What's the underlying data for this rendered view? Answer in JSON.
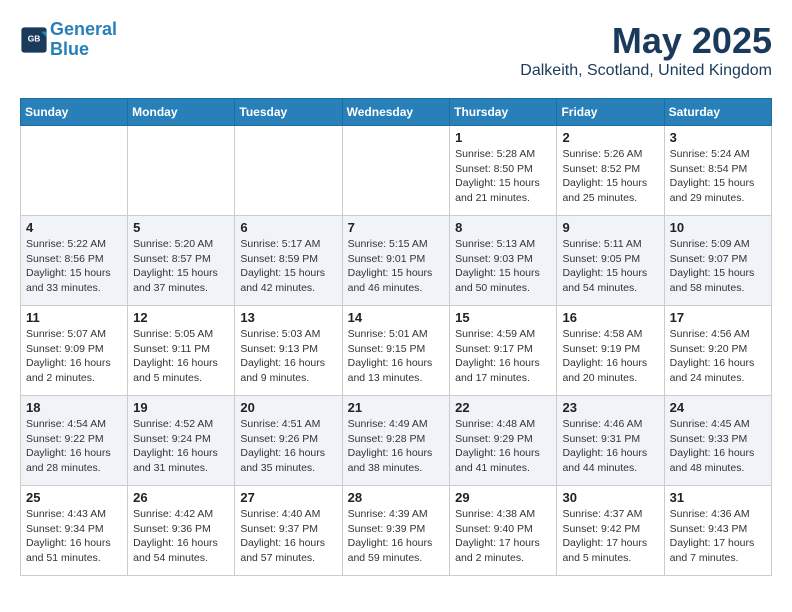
{
  "header": {
    "logo_line1": "General",
    "logo_line2": "Blue",
    "month_year": "May 2025",
    "location": "Dalkeith, Scotland, United Kingdom"
  },
  "days_of_week": [
    "Sunday",
    "Monday",
    "Tuesday",
    "Wednesday",
    "Thursday",
    "Friday",
    "Saturday"
  ],
  "weeks": [
    [
      {
        "day": "",
        "info": ""
      },
      {
        "day": "",
        "info": ""
      },
      {
        "day": "",
        "info": ""
      },
      {
        "day": "",
        "info": ""
      },
      {
        "day": "1",
        "info": "Sunrise: 5:28 AM\nSunset: 8:50 PM\nDaylight: 15 hours\nand 21 minutes."
      },
      {
        "day": "2",
        "info": "Sunrise: 5:26 AM\nSunset: 8:52 PM\nDaylight: 15 hours\nand 25 minutes."
      },
      {
        "day": "3",
        "info": "Sunrise: 5:24 AM\nSunset: 8:54 PM\nDaylight: 15 hours\nand 29 minutes."
      }
    ],
    [
      {
        "day": "4",
        "info": "Sunrise: 5:22 AM\nSunset: 8:56 PM\nDaylight: 15 hours\nand 33 minutes."
      },
      {
        "day": "5",
        "info": "Sunrise: 5:20 AM\nSunset: 8:57 PM\nDaylight: 15 hours\nand 37 minutes."
      },
      {
        "day": "6",
        "info": "Sunrise: 5:17 AM\nSunset: 8:59 PM\nDaylight: 15 hours\nand 42 minutes."
      },
      {
        "day": "7",
        "info": "Sunrise: 5:15 AM\nSunset: 9:01 PM\nDaylight: 15 hours\nand 46 minutes."
      },
      {
        "day": "8",
        "info": "Sunrise: 5:13 AM\nSunset: 9:03 PM\nDaylight: 15 hours\nand 50 minutes."
      },
      {
        "day": "9",
        "info": "Sunrise: 5:11 AM\nSunset: 9:05 PM\nDaylight: 15 hours\nand 54 minutes."
      },
      {
        "day": "10",
        "info": "Sunrise: 5:09 AM\nSunset: 9:07 PM\nDaylight: 15 hours\nand 58 minutes."
      }
    ],
    [
      {
        "day": "11",
        "info": "Sunrise: 5:07 AM\nSunset: 9:09 PM\nDaylight: 16 hours\nand 2 minutes."
      },
      {
        "day": "12",
        "info": "Sunrise: 5:05 AM\nSunset: 9:11 PM\nDaylight: 16 hours\nand 5 minutes."
      },
      {
        "day": "13",
        "info": "Sunrise: 5:03 AM\nSunset: 9:13 PM\nDaylight: 16 hours\nand 9 minutes."
      },
      {
        "day": "14",
        "info": "Sunrise: 5:01 AM\nSunset: 9:15 PM\nDaylight: 16 hours\nand 13 minutes."
      },
      {
        "day": "15",
        "info": "Sunrise: 4:59 AM\nSunset: 9:17 PM\nDaylight: 16 hours\nand 17 minutes."
      },
      {
        "day": "16",
        "info": "Sunrise: 4:58 AM\nSunset: 9:19 PM\nDaylight: 16 hours\nand 20 minutes."
      },
      {
        "day": "17",
        "info": "Sunrise: 4:56 AM\nSunset: 9:20 PM\nDaylight: 16 hours\nand 24 minutes."
      }
    ],
    [
      {
        "day": "18",
        "info": "Sunrise: 4:54 AM\nSunset: 9:22 PM\nDaylight: 16 hours\nand 28 minutes."
      },
      {
        "day": "19",
        "info": "Sunrise: 4:52 AM\nSunset: 9:24 PM\nDaylight: 16 hours\nand 31 minutes."
      },
      {
        "day": "20",
        "info": "Sunrise: 4:51 AM\nSunset: 9:26 PM\nDaylight: 16 hours\nand 35 minutes."
      },
      {
        "day": "21",
        "info": "Sunrise: 4:49 AM\nSunset: 9:28 PM\nDaylight: 16 hours\nand 38 minutes."
      },
      {
        "day": "22",
        "info": "Sunrise: 4:48 AM\nSunset: 9:29 PM\nDaylight: 16 hours\nand 41 minutes."
      },
      {
        "day": "23",
        "info": "Sunrise: 4:46 AM\nSunset: 9:31 PM\nDaylight: 16 hours\nand 44 minutes."
      },
      {
        "day": "24",
        "info": "Sunrise: 4:45 AM\nSunset: 9:33 PM\nDaylight: 16 hours\nand 48 minutes."
      }
    ],
    [
      {
        "day": "25",
        "info": "Sunrise: 4:43 AM\nSunset: 9:34 PM\nDaylight: 16 hours\nand 51 minutes."
      },
      {
        "day": "26",
        "info": "Sunrise: 4:42 AM\nSunset: 9:36 PM\nDaylight: 16 hours\nand 54 minutes."
      },
      {
        "day": "27",
        "info": "Sunrise: 4:40 AM\nSunset: 9:37 PM\nDaylight: 16 hours\nand 57 minutes."
      },
      {
        "day": "28",
        "info": "Sunrise: 4:39 AM\nSunset: 9:39 PM\nDaylight: 16 hours\nand 59 minutes."
      },
      {
        "day": "29",
        "info": "Sunrise: 4:38 AM\nSunset: 9:40 PM\nDaylight: 17 hours\nand 2 minutes."
      },
      {
        "day": "30",
        "info": "Sunrise: 4:37 AM\nSunset: 9:42 PM\nDaylight: 17 hours\nand 5 minutes."
      },
      {
        "day": "31",
        "info": "Sunrise: 4:36 AM\nSunset: 9:43 PM\nDaylight: 17 hours\nand 7 minutes."
      }
    ]
  ]
}
